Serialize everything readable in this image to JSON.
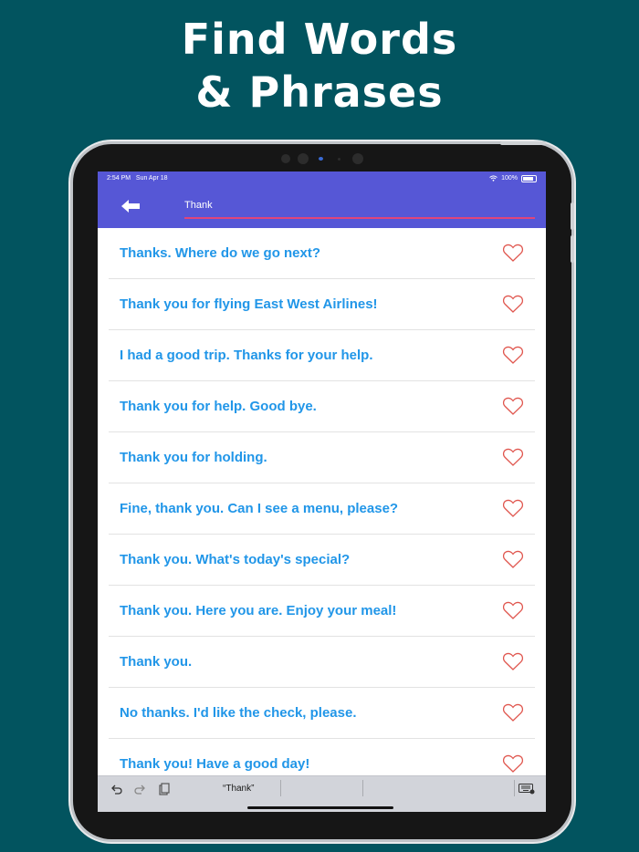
{
  "headline": {
    "line1": "Find Words",
    "line2": "& Phrases"
  },
  "status": {
    "time": "2:54 PM",
    "date": "Sun Apr 18",
    "battery": "100%"
  },
  "search": {
    "value": "Thank"
  },
  "phrases": [
    "Thanks. Where do we go next?",
    "Thank you for flying East West Airlines!",
    "I had a good trip. Thanks for your help.",
    "Thank you for help. Good bye.",
    "Thank you for holding.",
    "Fine, thank you. Can I see a menu, please?",
    "Thank you. What's today's special?",
    "Thank you. Here you are. Enjoy your meal!",
    "Thank you.",
    "No thanks. I'd like the check, please.",
    "Thank you! Have a good day!"
  ],
  "keyboard": {
    "suggestion": "“Thank”"
  },
  "colors": {
    "background": "#02545f",
    "accent": "#5657d6",
    "phrase_text": "#2196e8",
    "heart": "#e0564e",
    "underline": "#e0457a"
  },
  "icons": {
    "back": "arrow-left-icon",
    "favorite": "heart-outline-icon",
    "undo": "undo-icon",
    "redo": "redo-icon",
    "paste": "clipboard-icon",
    "keyboard": "keyboard-icon",
    "wifi": "wifi-icon",
    "battery": "battery-icon"
  }
}
